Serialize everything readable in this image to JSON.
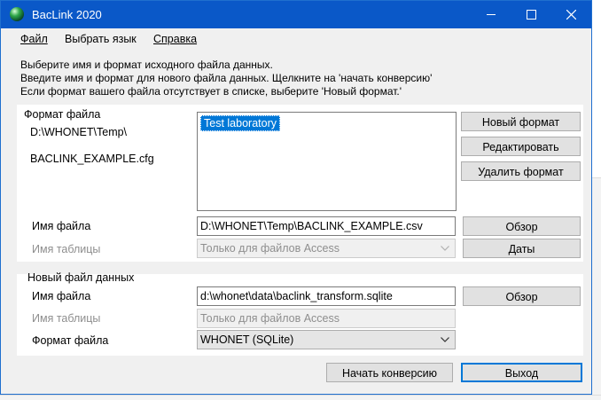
{
  "window": {
    "title": "BacLink 2020"
  },
  "menu": {
    "file": "Файл",
    "language": "Выбрать язык",
    "help": "Справка"
  },
  "instructions": [
    "Выберите имя и формат исходного файла данных.",
    "Введите имя и формат для нового файла данных.  Щелкните на 'начать конверсию'",
    "Если формат вашего файла отсутствует в списке, выберите 'Новый формат.'"
  ],
  "source": {
    "format_label": "Формат файла",
    "folder": "D:\\WHONET\\Temp\\",
    "config_file": "BACLINK_EXAMPLE.cfg",
    "formats_list": [
      "Test laboratory"
    ],
    "selected_format": "Test laboratory",
    "new_format_button": "Новый формат",
    "edit_button": "Редактировать",
    "delete_button": "Удалить формат",
    "filename_label": "Имя файла",
    "filename_value": "D:\\WHONET\\Temp\\BACLINK_EXAMPLE.csv",
    "browse_button": "Обзор",
    "table_label": "Имя таблицы",
    "table_value": "Только для файлов Access",
    "dates_button": "Даты"
  },
  "target": {
    "section_label": "Новый файл данных",
    "filename_label": "Имя файла",
    "filename_value": "d:\\whonet\\data\\baclink_transform.sqlite",
    "browse_button": "Обзор",
    "table_label": "Имя таблицы",
    "table_value": "Только для файлов Access",
    "format_label": "Формат файла",
    "format_value": "WHONET (SQLite)"
  },
  "footer": {
    "start_button": "Начать конверсию",
    "exit_button": "Выход"
  }
}
